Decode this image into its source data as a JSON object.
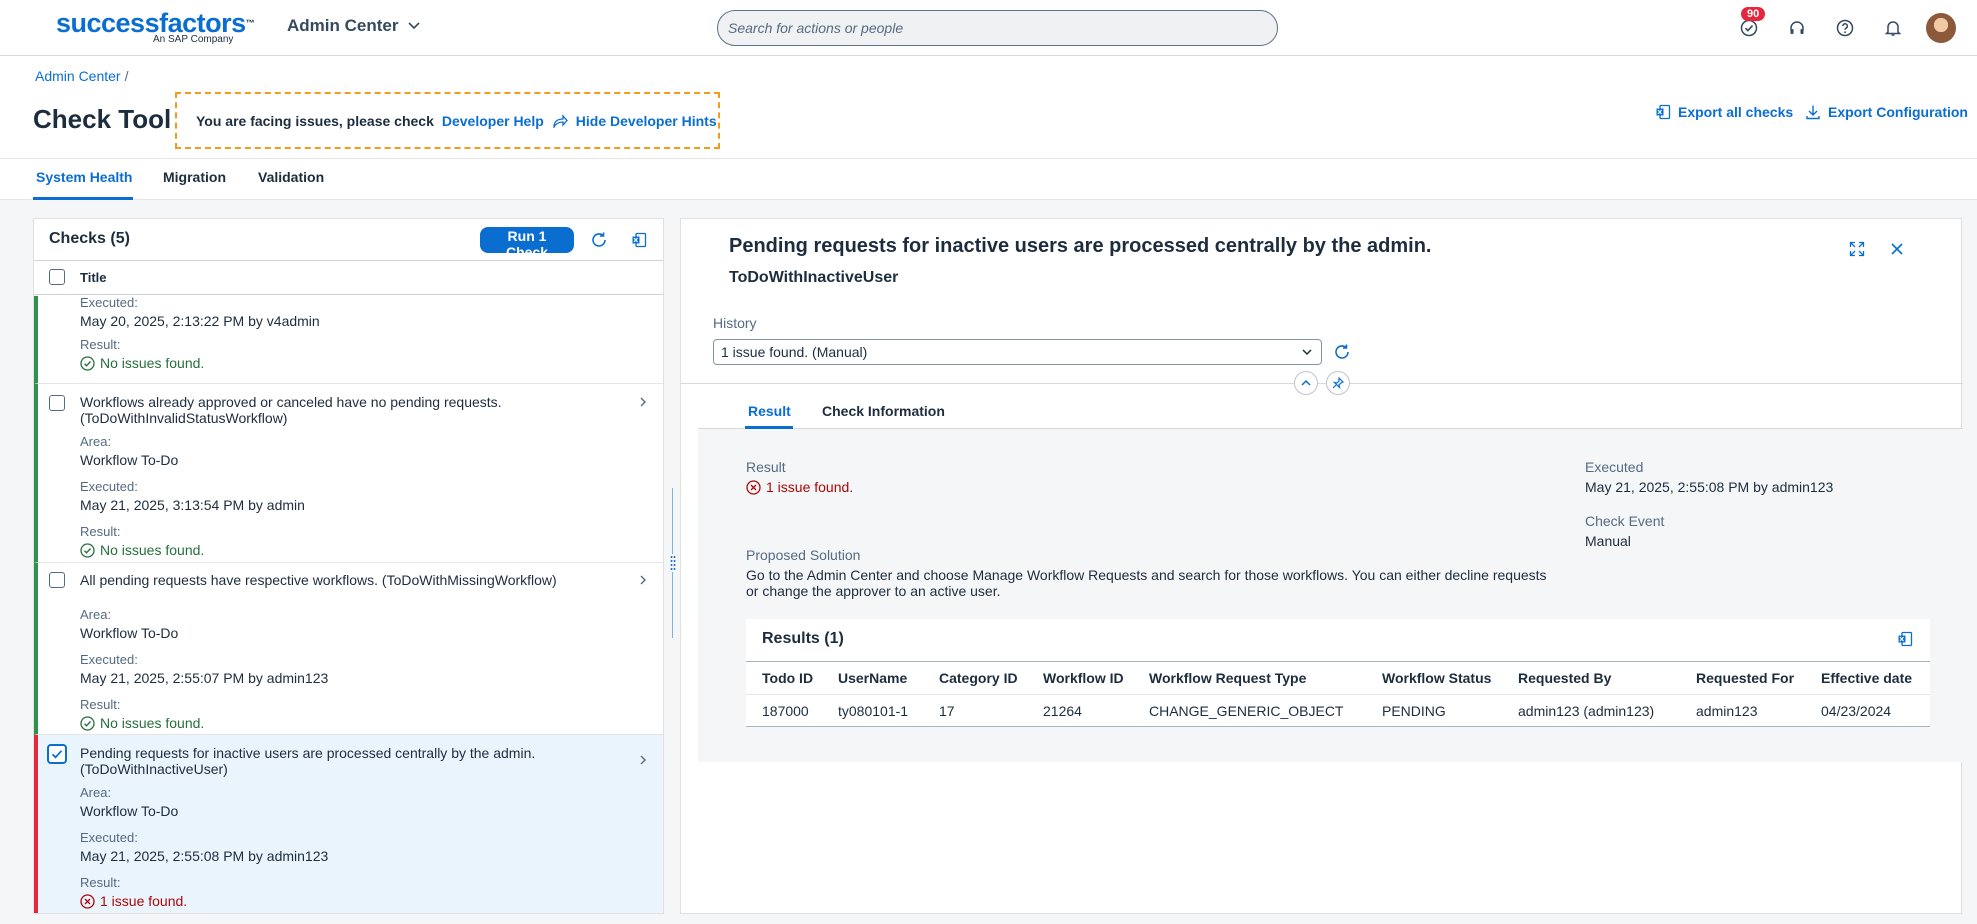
{
  "shell": {
    "logo_text": "successfactors",
    "logo_tm": "™",
    "logo_sub": "An SAP Company",
    "app_title": "Admin Center",
    "search_placeholder": "Search for actions or people",
    "notification_count": "90"
  },
  "header": {
    "breadcrumb_root": "Admin Center",
    "breadcrumb_sep": "/",
    "page_title": "Check Tool",
    "dev_hint_text": "You are facing issues, please check",
    "dev_help_link": "Developer Help",
    "hide_hints_link": "Hide Developer Hints",
    "export_all": "Export all checks",
    "export_config": "Export Configuration"
  },
  "tabs": [
    {
      "label": "System Health",
      "active": true
    },
    {
      "label": "Migration",
      "active": false
    },
    {
      "label": "Validation",
      "active": false
    }
  ],
  "checks": {
    "title": "Checks (5)",
    "run_button": "Run 1 Check",
    "column_title": "Title",
    "labels": {
      "area": "Area:",
      "executed": "Executed:",
      "result": "Result:"
    },
    "rows": [
      {
        "executed": "May 20, 2025, 2:13:22 PM by v4admin",
        "result": "No issues found."
      },
      {
        "title_line1": "Workflows already approved or canceled have no pending requests.",
        "title_line2": "(ToDoWithInvalidStatusWorkflow)",
        "area": "Workflow To-Do",
        "executed": "May 21, 2025, 3:13:54 PM by admin",
        "result": "No issues found."
      },
      {
        "title_line1": "All pending requests have respective workflows. (ToDoWithMissingWorkflow)",
        "area": "Workflow To-Do",
        "executed": "May 21, 2025, 2:55:07 PM by admin123",
        "result": "No issues found."
      },
      {
        "title_line1": "Pending requests for inactive users are processed centrally by the admin.",
        "title_line2": "(ToDoWithInactiveUser)",
        "area": "Workflow To-Do",
        "executed": "May 21, 2025, 2:55:08 PM by admin123",
        "result": "1 issue found.",
        "selected": true
      }
    ]
  },
  "detail": {
    "title": "Pending requests for inactive users are processed centrally by the admin.",
    "subtitle": "ToDoWithInactiveUser",
    "history_label": "History",
    "history_value": "1 issue found. (Manual)",
    "tabs": [
      {
        "label": "Result",
        "active": true
      },
      {
        "label": "Check Information",
        "active": false
      }
    ],
    "result_label": "Result",
    "result_value": "1 issue found.",
    "executed_label": "Executed",
    "executed_value": "May 21, 2025, 2:55:08 PM by admin123",
    "check_event_label": "Check Event",
    "check_event_value": "Manual",
    "proposed_label": "Proposed Solution",
    "proposed_line1": "Go to the Admin Center and choose Manage Workflow Requests and search for those workflows. You can either decline requests",
    "proposed_line2": "or change the approver to an active user.",
    "results_title": "Results (1)",
    "columns": [
      "Todo ID",
      "UserName",
      "Category ID",
      "Workflow ID",
      "Workflow Request Type",
      "Workflow Status",
      "Requested By",
      "Requested For",
      "Effective date"
    ],
    "rows": [
      [
        "187000",
        "ty080101-1",
        "17",
        "21264",
        "CHANGE_GENERIC_OBJECT",
        "PENDING",
        "admin123 (admin123)",
        "admin123",
        "04/23/2024"
      ]
    ]
  },
  "colors": {
    "accent": "#0a6ed1",
    "success": "#30914c",
    "error": "#e4283d",
    "highlight": "#f29b1d"
  }
}
